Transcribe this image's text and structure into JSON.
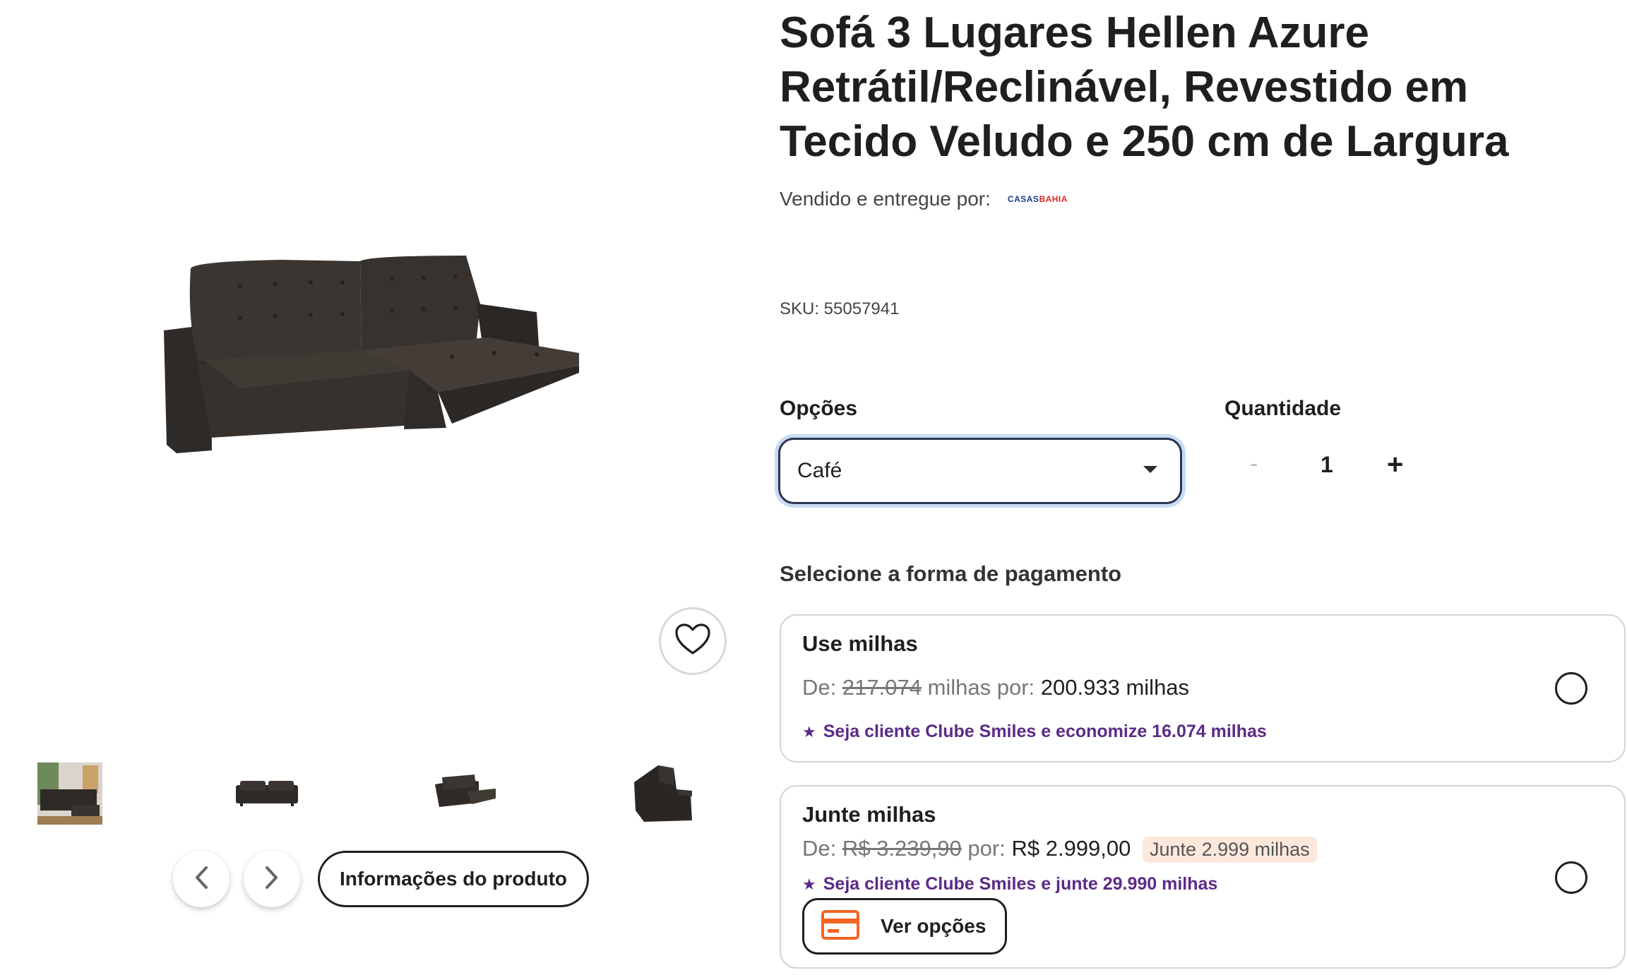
{
  "product": {
    "title": "Sofá 3 Lugares Hellen Azure Retrátil/Reclinável, Revestido em Tecido Veludo e 250 cm de Largura",
    "seller_label": "Vendido e entregue por:",
    "seller_logo_part1": "CASAS",
    "seller_logo_part2": "BAHIA",
    "sku": "SKU: 55057941"
  },
  "gallery": {
    "main_image_icon": "sofa-image",
    "thumbnails": [
      "sofa-living-room-photo",
      "sofa-front-thumb",
      "sofa-angle-thumb",
      "sofa-side-thumb"
    ],
    "prev_icon": "chevron-left-icon",
    "next_icon": "chevron-right-icon",
    "info_button_label": "Informações do produto",
    "favorite_icon": "heart-icon"
  },
  "options": {
    "label": "Opções",
    "selected": "Café"
  },
  "quantity": {
    "label": "Quantidade",
    "minus": "-",
    "value": "1",
    "plus": "+"
  },
  "payment": {
    "heading": "Selecione a forma de pagamento",
    "use_miles": {
      "title": "Use milhas",
      "from_label": "De:",
      "old_value": "217.074",
      "mid_text": "milhas por:",
      "new_value": "200.933 milhas",
      "promo": "Seja cliente Clube Smiles e economize 16.074 milhas"
    },
    "earn_miles": {
      "title": "Junte milhas",
      "from_label": "De:",
      "old_price": "R$ 3.239,90",
      "mid_text": "por:",
      "new_price": "R$ 2.999,00",
      "badge": "Junte 2.999 milhas",
      "promo": "Seja cliente Clube Smiles e junte 29.990 milhas",
      "options_button": "Ver opções"
    }
  },
  "colors": {
    "promo_purple": "#5b2b86",
    "card_icon_orange": "#f26522",
    "select_focus": "#c8dcf4"
  }
}
